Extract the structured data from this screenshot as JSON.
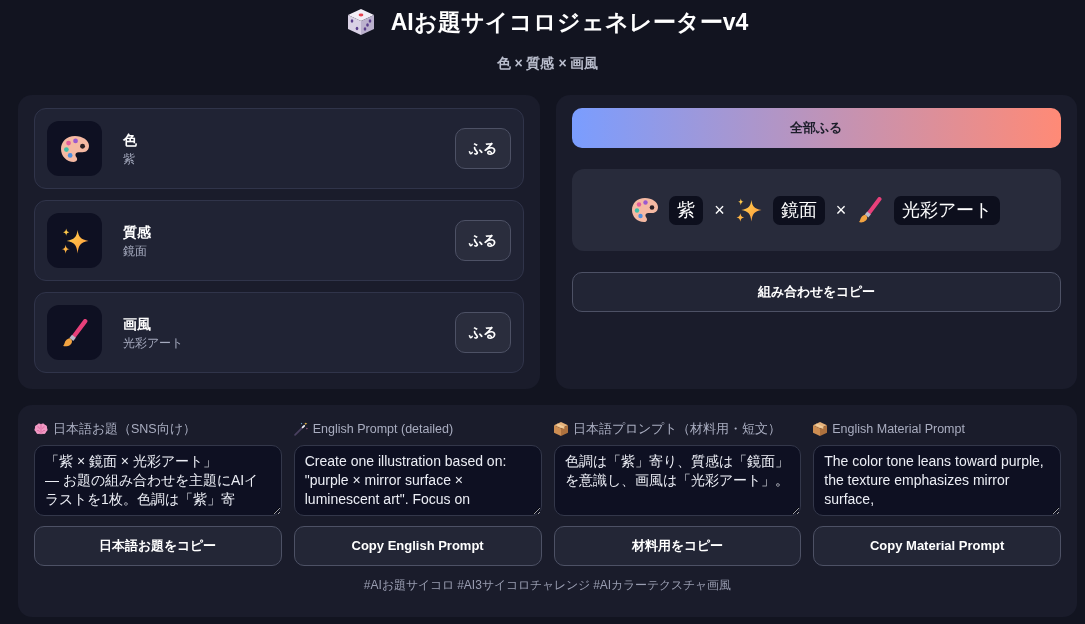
{
  "header": {
    "title": "AIお題サイコロジェネレーターv4",
    "subtitle": "色 × 質感 × 画風"
  },
  "dice": [
    {
      "kind": "color",
      "label": "色",
      "value": "紫",
      "button": "ふる"
    },
    {
      "kind": "texture",
      "label": "質感",
      "value": "鏡面",
      "button": "ふる"
    },
    {
      "kind": "style",
      "label": "画風",
      "value": "光彩アート",
      "button": "ふる"
    }
  ],
  "roll_all_button": "全部ふる",
  "combination": [
    {
      "kind": "color",
      "text": "紫"
    },
    {
      "kind": "separator",
      "text": "×"
    },
    {
      "kind": "texture",
      "text": "鏡面"
    },
    {
      "kind": "separator",
      "text": "×"
    },
    {
      "kind": "style",
      "text": "光彩アート"
    }
  ],
  "copy_combination_button": "組み合わせをコピー",
  "prompts": [
    {
      "kind": "sns",
      "label": "日本語お題（SNS向け）",
      "text": "「紫 × 鏡面 × 光彩アート」\n— お題の組み合わせを主題にAIイラストを1枚。色調は「紫」寄",
      "button": "日本語お題をコピー"
    },
    {
      "kind": "detailed",
      "label": "English Prompt (detailed)",
      "text": "Create one illustration based on: \"purple × mirror surface × luminescent art\". Focus on",
      "button": "Copy English Prompt"
    },
    {
      "kind": "material",
      "label": "日本語プロンプト（材料用・短文）",
      "text": "色調は「紫」寄り、質感は「鏡面」を意識し、画風は「光彩アート」。",
      "button": "材料用をコピー"
    },
    {
      "kind": "material",
      "label": "English Material Prompt",
      "text": "The color tone leans toward purple, the texture emphasizes mirror surface,",
      "button": "Copy Material Prompt"
    }
  ],
  "hashtags": "#AIお題サイコロ #AI3サイコロチャレンジ #AIカラーテクスチャ画風"
}
